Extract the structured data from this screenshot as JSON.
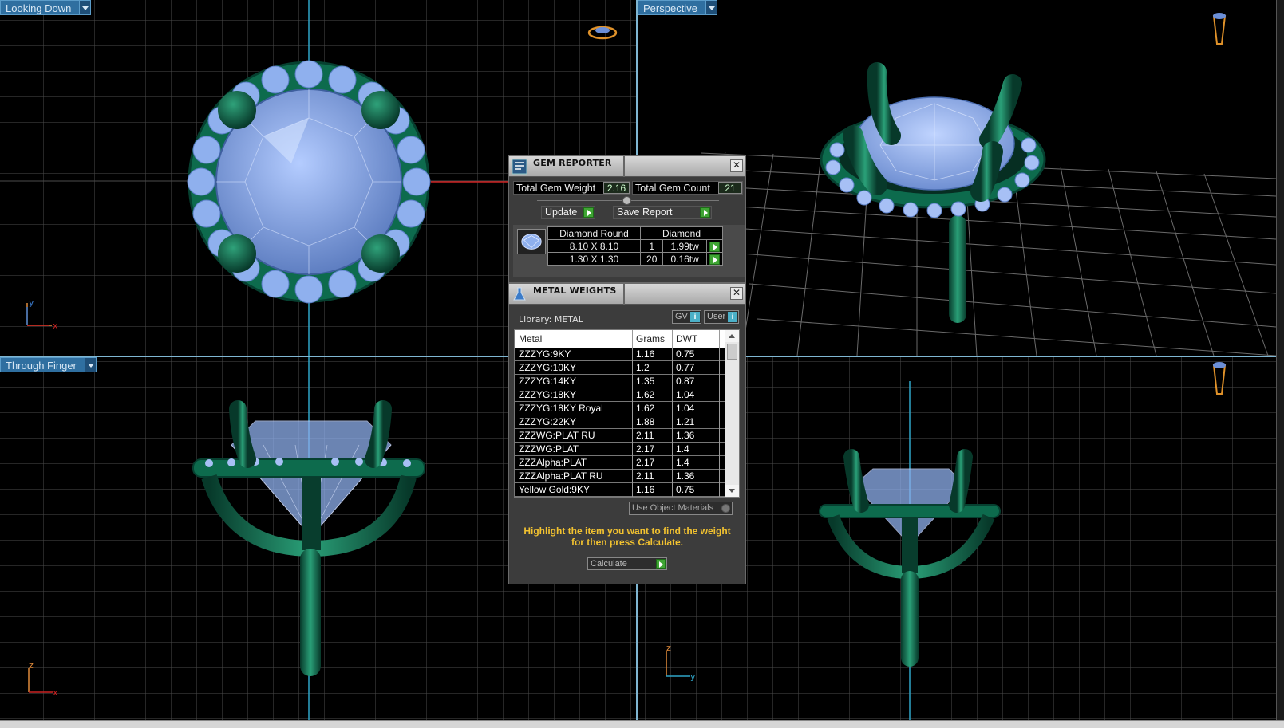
{
  "viewports": {
    "top_left": {
      "label": "Looking Down",
      "axis_a": "y",
      "axis_b": "x"
    },
    "top_right": {
      "label": "Perspective"
    },
    "bottom_left": {
      "label": "Through Finger",
      "axis_a": "z",
      "axis_b": "x"
    },
    "bottom_right": {
      "axis_a": "z",
      "axis_b": "y"
    }
  },
  "gem_reporter": {
    "title": "GEM REPORTER",
    "total_weight_label": "Total Gem Weight",
    "total_weight_value": "2.16",
    "total_count_label": "Total Gem Count",
    "total_count_value": "21",
    "update_label": "Update",
    "save_label": "Save Report",
    "table": {
      "header_type": "Diamond Round",
      "header_material": "Diamond",
      "rows": [
        {
          "size": "8.10 X 8.10",
          "count": "1",
          "weight": "1.99tw"
        },
        {
          "size": "1.30 X 1.30",
          "count": "20",
          "weight": "0.16tw"
        }
      ]
    }
  },
  "metal_weights": {
    "title": "METAL WEIGHTS",
    "library_label": "Library: METAL",
    "gv_label": "GV",
    "user_label": "User",
    "info_glyph": "i",
    "columns": {
      "metal": "Metal",
      "grams": "Grams",
      "dwt": "DWT"
    },
    "rows": [
      {
        "metal": "ZZZYG:9KY",
        "grams": "1.16",
        "dwt": "0.75"
      },
      {
        "metal": "ZZZYG:10KY",
        "grams": "1.2",
        "dwt": "0.77"
      },
      {
        "metal": "ZZZYG:14KY",
        "grams": "1.35",
        "dwt": "0.87"
      },
      {
        "metal": "ZZZYG:18KY",
        "grams": "1.62",
        "dwt": "1.04"
      },
      {
        "metal": "ZZZYG:18KY Royal",
        "grams": "1.62",
        "dwt": "1.04"
      },
      {
        "metal": "ZZZYG:22KY",
        "grams": "1.88",
        "dwt": "1.21"
      },
      {
        "metal": "ZZZWG:PLAT RU",
        "grams": "2.11",
        "dwt": "1.36"
      },
      {
        "metal": "ZZZWG:PLAT",
        "grams": "2.17",
        "dwt": "1.4"
      },
      {
        "metal": "ZZZAlpha:PLAT",
        "grams": "2.17",
        "dwt": "1.4"
      },
      {
        "metal": "ZZZAlpha:PLAT RU",
        "grams": "2.11",
        "dwt": "1.36"
      },
      {
        "metal": "Yellow Gold:9KY",
        "grams": "1.16",
        "dwt": "0.75"
      }
    ],
    "use_object_label": "Use Object Materials",
    "hint": "Highlight the item you want to find the weight for then press Calculate.",
    "calculate_label": "Calculate"
  },
  "colors": {
    "metal": "#0d6b4d",
    "gem": "#8fb0ee",
    "grid": "#555555",
    "accent": "#2f6fa0"
  }
}
